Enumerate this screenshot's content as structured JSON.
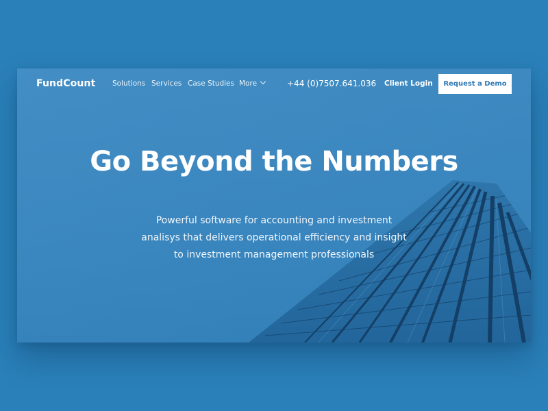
{
  "brand": {
    "name": "FundCount"
  },
  "nav": {
    "items": [
      {
        "label": "Solutions"
      },
      {
        "label": "Services"
      },
      {
        "label": "Case Studies"
      },
      {
        "label": "More"
      }
    ],
    "phone": "+44 (0)7507.641.036",
    "login_label": "Client Login",
    "demo_label": "Request a Demo"
  },
  "hero": {
    "title": "Go Beyond the Numbers",
    "subtitle_lines": [
      "Powerful software for accounting and investment",
      "analisys that delivers operational efficiency and insight",
      "to investment management professionals"
    ]
  },
  "colors": {
    "page_background": "#2a80b9",
    "hero_background": "#3a86bf",
    "button_background": "#ffffff",
    "button_text": "#2f79b2"
  }
}
